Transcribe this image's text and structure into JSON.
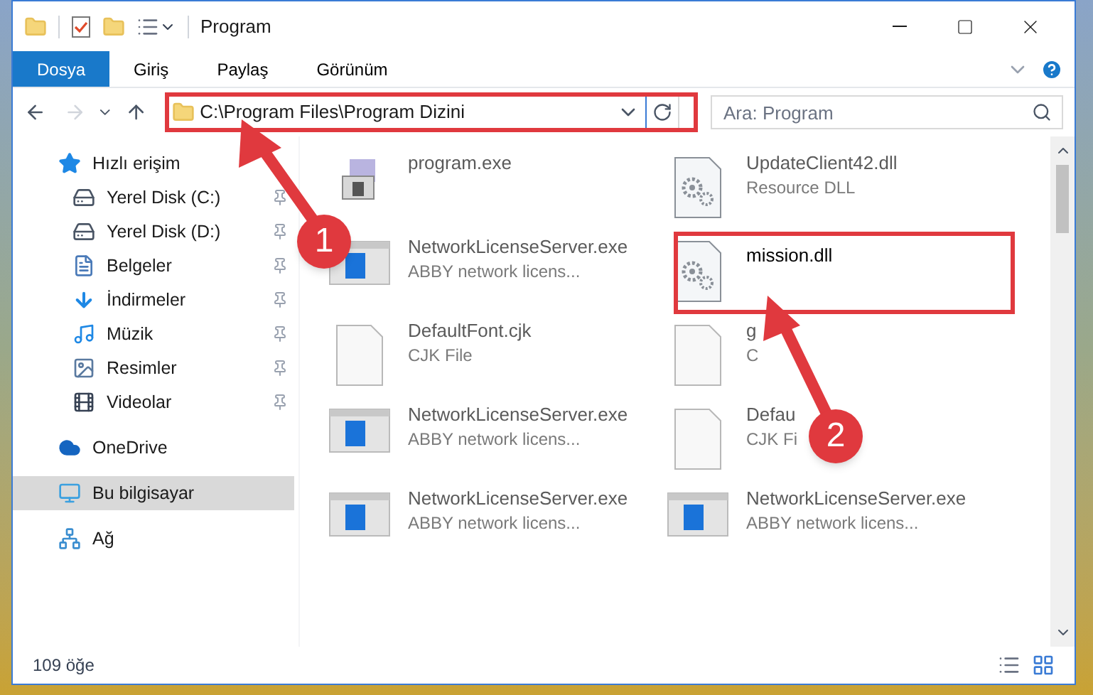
{
  "window": {
    "title": "Program"
  },
  "ribbon_tabs": [
    {
      "label": "Dosya",
      "selected": true
    },
    {
      "label": "Giriş",
      "selected": false
    },
    {
      "label": "Paylaş",
      "selected": false
    },
    {
      "label": "Görünüm",
      "selected": false
    }
  ],
  "address": {
    "path": "C:\\Program Files\\Program Dizini"
  },
  "search": {
    "placeholder": "Ara: Program"
  },
  "sidebar": {
    "items": [
      {
        "label": "Hızlı erişim",
        "kind": "quick",
        "pinned": false,
        "selected": false,
        "children": [
          {
            "label": "Yerel Disk (C:)",
            "kind": "disk-c",
            "pinned": true,
            "selected": false
          },
          {
            "label": "Yerel Disk (D:)",
            "kind": "disk",
            "pinned": true,
            "selected": false
          },
          {
            "label": "Belgeler",
            "kind": "docs",
            "pinned": true,
            "selected": false
          },
          {
            "label": "İndirmeler",
            "kind": "downloads",
            "pinned": true,
            "selected": false
          },
          {
            "label": "Müzik",
            "kind": "music",
            "pinned": true,
            "selected": false
          },
          {
            "label": "Resimler",
            "kind": "pictures",
            "pinned": true,
            "selected": false
          },
          {
            "label": "Videolar",
            "kind": "videos",
            "pinned": true,
            "selected": false
          }
        ]
      },
      {
        "label": "OneDrive",
        "kind": "cloud",
        "pinned": false,
        "selected": false
      },
      {
        "label": "Bu bilgisayar",
        "kind": "pc",
        "pinned": false,
        "selected": true
      },
      {
        "label": "Ağ",
        "kind": "network",
        "pinned": false,
        "selected": false
      }
    ]
  },
  "files": [
    {
      "name": "program.exe",
      "kind": "exe"
    },
    {
      "name": "UpdateClient42.dll",
      "type": "Resource DLL",
      "kind": "dll"
    },
    {
      "name": "NetworkLicenseServer.exe",
      "type": "ABBY network licens...",
      "kind": "app"
    },
    {
      "name": "mission.dll",
      "kind": "dll"
    },
    {
      "name": "DefaultFont.cjk",
      "type": "CJK File",
      "kind": "file"
    },
    {
      "name": "g",
      "type": "C",
      "kind": "file"
    },
    {
      "name": "NetworkLicenseServer.exe",
      "type": "ABBY network licens...",
      "kind": "app"
    },
    {
      "name": "Defau",
      "type": "CJK Fi",
      "kind": "file"
    },
    {
      "name": "NetworkLicenseServer.exe",
      "type": "ABBY network licens...",
      "kind": "app"
    },
    {
      "name": "NetworkLicenseServer.exe",
      "type": "ABBY network licens...",
      "kind": "app"
    }
  ],
  "status_bar": {
    "count": "109 öğe"
  },
  "annotations": [
    {
      "number": "1"
    },
    {
      "number": "2"
    }
  ]
}
